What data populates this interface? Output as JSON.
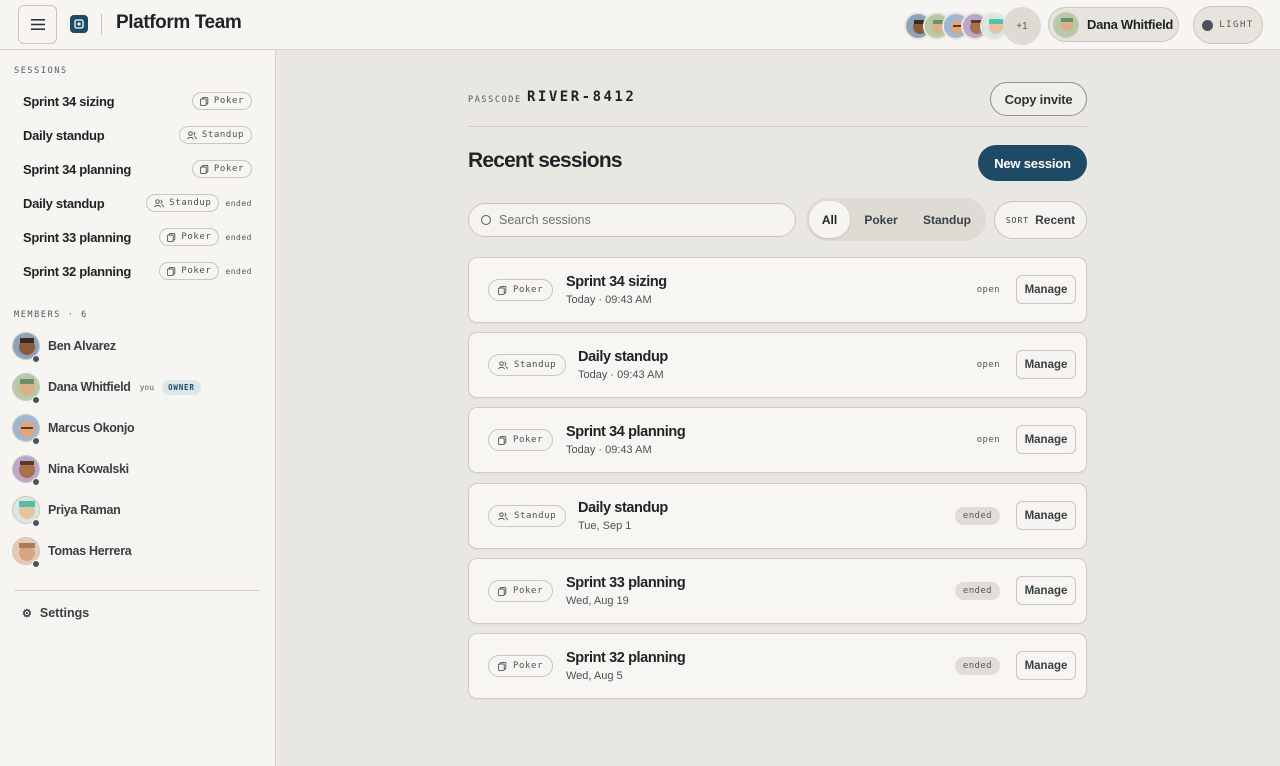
{
  "header": {
    "title": "Platform Team",
    "more_count": "+1",
    "user_name": "Dana Whitfield",
    "theme_label": "LIGHT"
  },
  "sidebar": {
    "sessions_label": "SESSIONS",
    "sessions": [
      {
        "name": "Sprint 34 sizing",
        "type": "Poker",
        "ended": ""
      },
      {
        "name": "Daily standup",
        "type": "Standup",
        "ended": ""
      },
      {
        "name": "Sprint 34 planning",
        "type": "Poker",
        "ended": ""
      },
      {
        "name": "Daily standup",
        "type": "Standup",
        "ended": "ended"
      },
      {
        "name": "Sprint 33 planning",
        "type": "Poker",
        "ended": "ended"
      },
      {
        "name": "Sprint 32 planning",
        "type": "Poker",
        "ended": "ended"
      }
    ],
    "members_label": "MEMBERS · 6",
    "members": [
      {
        "name": "Ben Alvarez"
      },
      {
        "name": "Dana Whitfield",
        "you": "you",
        "badge": "OWNER"
      },
      {
        "name": "Marcus Okonjo"
      },
      {
        "name": "Nina Kowalski"
      },
      {
        "name": "Priya Raman"
      },
      {
        "name": "Tomas Herrera"
      }
    ],
    "settings_label": "Settings"
  },
  "main": {
    "passcode_label": "PASSCODE",
    "passcode_value": "RIVER-8412",
    "copy_invite_label": "Copy invite",
    "recent_title": "Recent sessions",
    "new_session_label": "New session",
    "search_placeholder": "Search sessions",
    "filters": [
      "All",
      "Poker",
      "Standup"
    ],
    "sort_label": "SORT",
    "sort_value": "Recent",
    "manage_label": "Manage",
    "cards": [
      {
        "type": "Poker",
        "title": "Sprint 34 sizing",
        "sub": "Today · 09:43 AM",
        "status": "open"
      },
      {
        "type": "Standup",
        "title": "Daily standup",
        "sub": "Today · 09:43 AM",
        "status": "open"
      },
      {
        "type": "Poker",
        "title": "Sprint 34 planning",
        "sub": "Today · 09:43 AM",
        "status": "open"
      },
      {
        "type": "Standup",
        "title": "Daily standup",
        "sub": "Tue, Sep 1",
        "status": "ended"
      },
      {
        "type": "Poker",
        "title": "Sprint 33 planning",
        "sub": "Wed, Aug 19",
        "status": "ended"
      },
      {
        "type": "Poker",
        "title": "Sprint 32 planning",
        "sub": "Wed, Aug 5",
        "status": "ended"
      }
    ]
  },
  "colors": {
    "accent": "#1f4a66",
    "background": "#e9e7e2",
    "panel": "#f6f5f1"
  },
  "icons": {
    "poker": "cards-icon",
    "standup": "people-icon",
    "settings": "gear-icon",
    "search": "search-icon",
    "menu": "hamburger-icon"
  }
}
